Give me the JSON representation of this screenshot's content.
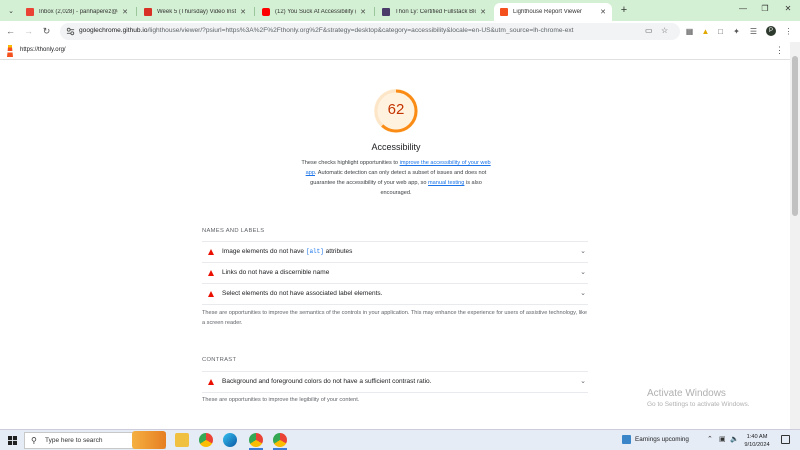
{
  "browser": {
    "tabs": [
      {
        "title": "Inbox (2,028) - panhaperez@g...",
        "favicon_color": "#ea4335",
        "active": false
      },
      {
        "title": "Week 5 (Thursday) Video Instr...",
        "favicon_color": "#d93025",
        "active": false
      },
      {
        "title": "(12) You Suck At Accessibility (I...",
        "favicon_color": "#ff0000",
        "active": false
      },
      {
        "title": "Thon Ly: Certified Fullstack Blo...",
        "favicon_color": "#4b3b6b",
        "active": false
      },
      {
        "title": "Lighthouse Report Viewer",
        "favicon_color": "#f4511e",
        "active": true
      }
    ],
    "url_host": "googlechrome.github.io",
    "url_rest": "/lighthouse/viewer/?psiurl=https%3A%2F%2Fthonly.org%2F&strategy=desktop&category=accessibility&locale=en-US&utm_source=lh-chrome-ext",
    "profile_initial": "P"
  },
  "lighthouse": {
    "site_url": "https://thonly.org/",
    "score": 62,
    "score_color": "#fa8c16",
    "category_title": "Accessibility",
    "desc": {
      "p1": "These checks highlight opportunities to ",
      "link1": "improve the accessibility of your web app",
      "p2": ". Automatic detection can only detect a subset of issues and does not guarantee the accessibility of your web app, so ",
      "link2": "manual testing",
      "p3": " is also encouraged."
    },
    "groups": [
      {
        "title": "NAMES AND LABELS",
        "audits": [
          {
            "pre": "Image elements do not have ",
            "code": "[alt]",
            "post": " attributes"
          },
          {
            "pre": "Links do not have a discernible name",
            "code": "",
            "post": ""
          },
          {
            "pre": "Select elements do not have associated label elements.",
            "code": "",
            "post": ""
          }
        ],
        "description": "These are opportunities to improve the semantics of the controls in your application. This may enhance the experience for users of assistive technology, like a screen reader."
      },
      {
        "title": "CONTRAST",
        "audits": [
          {
            "pre": "Background and foreground colors do not have a sufficient contrast ratio.",
            "code": "",
            "post": ""
          }
        ],
        "description": "These are opportunities to improve the legibility of your content."
      }
    ]
  },
  "watermark": {
    "line1": "Activate Windows",
    "line2": "Go to Settings to activate Windows."
  },
  "taskbar": {
    "search_placeholder": "Type here to search",
    "weather": "Earnings upcoming",
    "time": "1:40 AM",
    "date": "9/10/2024"
  }
}
